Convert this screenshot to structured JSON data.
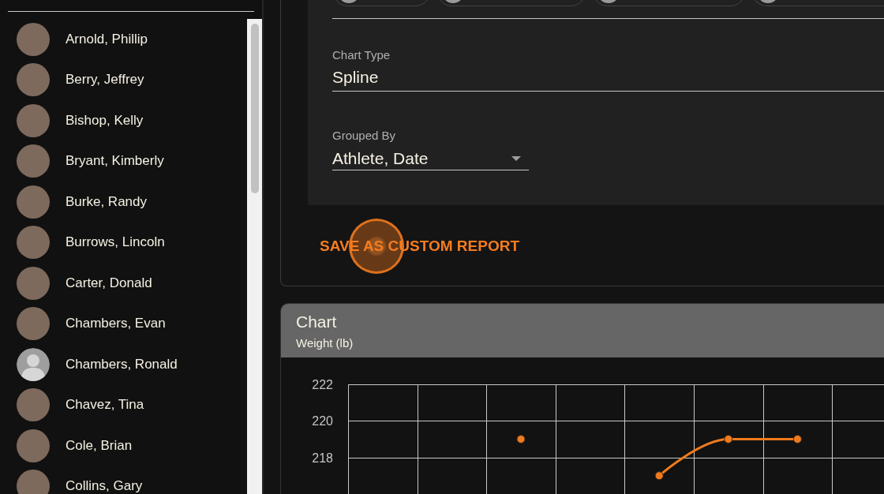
{
  "athlete_list": [
    {
      "name": "Arnold, Phillip",
      "kind": "photo"
    },
    {
      "name": "Berry, Jeffrey",
      "kind": "photo"
    },
    {
      "name": "Bishop, Kelly",
      "kind": "photo"
    },
    {
      "name": "Bryant, Kimberly",
      "kind": "photo"
    },
    {
      "name": "Burke, Randy",
      "kind": "photo"
    },
    {
      "name": "Burrows, Lincoln",
      "kind": "photo"
    },
    {
      "name": "Carter, Donald",
      "kind": "photo"
    },
    {
      "name": "Chambers, Evan",
      "kind": "photo"
    },
    {
      "name": "Chambers, Ronald",
      "kind": "default"
    },
    {
      "name": "Chavez, Tina",
      "kind": "photo"
    },
    {
      "name": "Cole, Brian",
      "kind": "photo"
    },
    {
      "name": "Collins, Gary",
      "kind": "photo"
    }
  ],
  "report_settings": {
    "athlete_chips": [
      {
        "kind": "photo"
      },
      {
        "kind": "photo"
      },
      {
        "kind": "photo"
      },
      {
        "kind": "photo"
      }
    ],
    "chart_type": {
      "label": "Chart Type",
      "value": "Spline"
    },
    "grouped_by": {
      "label": "Grouped By",
      "value": "Athlete, Date"
    }
  },
  "save_button": {
    "label": "SAVE AS CUSTOM REPORT",
    "pressed": true
  },
  "chart_card": {
    "title": "Chart",
    "subtitle": "Weight (lb)",
    "chart_data": {
      "type": "line",
      "ylim": [
        216,
        222
      ],
      "yticks": [
        218,
        220,
        222
      ],
      "series": [
        {
          "color": "#f07a1c",
          "marker": true,
          "values": [
            null,
            null,
            219,
            null,
            217,
            219,
            219,
            null
          ]
        }
      ]
    }
  }
}
